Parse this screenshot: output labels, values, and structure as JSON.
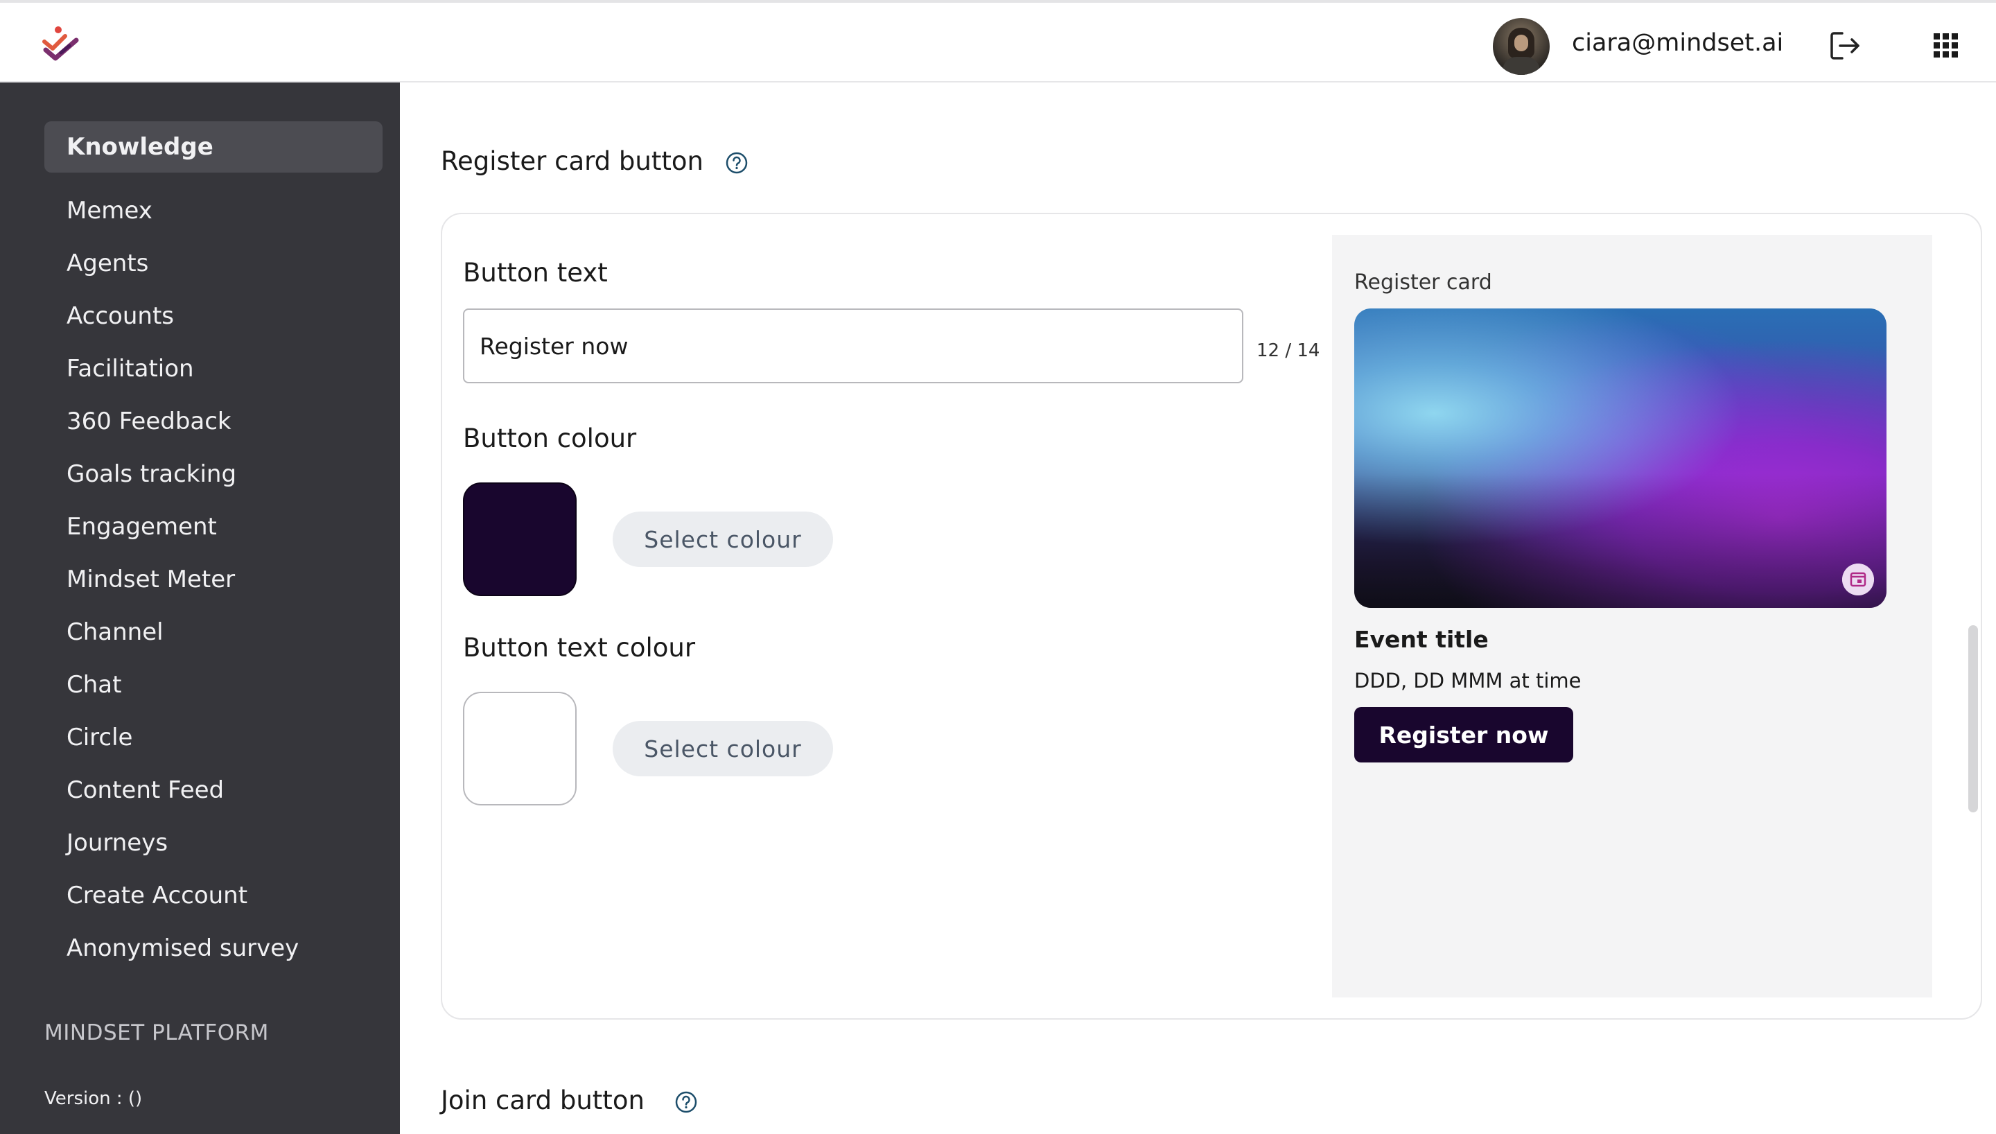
{
  "header": {
    "user_email": "ciara@mindset.ai"
  },
  "sidebar": {
    "items": [
      {
        "label": "Knowledge",
        "active": true
      },
      {
        "label": "Memex"
      },
      {
        "label": "Agents"
      },
      {
        "label": "Accounts"
      },
      {
        "label": "Facilitation"
      },
      {
        "label": "360 Feedback"
      },
      {
        "label": "Goals tracking"
      },
      {
        "label": "Engagement"
      },
      {
        "label": "Mindset Meter"
      },
      {
        "label": "Channel"
      },
      {
        "label": "Chat"
      },
      {
        "label": "Circle"
      },
      {
        "label": "Content Feed"
      },
      {
        "label": "Journeys"
      },
      {
        "label": "Create Account"
      },
      {
        "label": "Anonymised survey"
      }
    ],
    "platform_label": "MINDSET PLATFORM",
    "version_label": "Version :  ()"
  },
  "register_section": {
    "title": "Register card button",
    "button_text": {
      "label": "Button text",
      "value": "Register now",
      "char_count": "12 / 14"
    },
    "button_colour": {
      "label": "Button colour",
      "swatch": "#19062e",
      "select_label": "Select colour"
    },
    "button_text_colour": {
      "label": "Button text colour",
      "swatch": "#ffffff",
      "select_label": "Select colour"
    },
    "preview": {
      "label": "Register card",
      "event_title": "Event title",
      "event_date": "DDD, DD MMM at time",
      "button_label": "Register now"
    }
  },
  "join_section": {
    "title": "Join card button"
  },
  "colors": {
    "sidebar_bg": "#36363b",
    "accent_button": "#19062e",
    "select_button_bg": "#ebedf0"
  },
  "icons": {
    "logo": "mindset-logo-icon",
    "logout": "logout-icon",
    "apps": "apps-grid-icon",
    "help": "help-circle-icon",
    "calendar": "calendar-icon"
  }
}
